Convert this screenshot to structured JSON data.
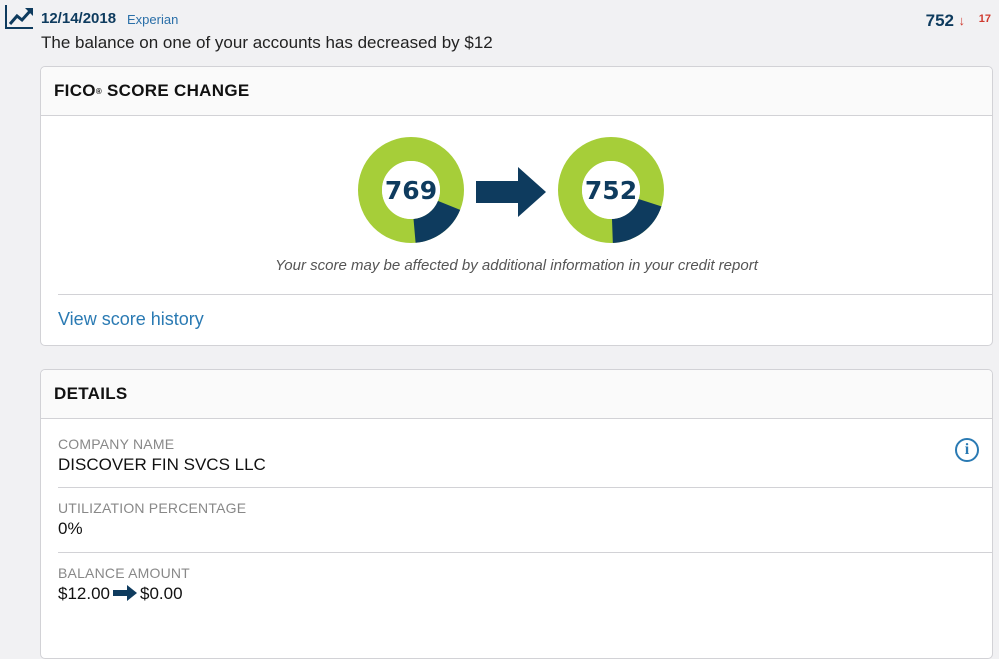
{
  "alert": {
    "icon": "trend-up-icon",
    "date": "12/14/2018",
    "bureau": "Experian",
    "message": "The balance on one of your accounts has decreased by $12",
    "score": "752",
    "delta_arrow": "↓",
    "delta": "17"
  },
  "fico_card": {
    "title": "FICO",
    "title_mark": "®",
    "title_rest": " SCORE CHANGE",
    "old_score": "769",
    "new_score": "752",
    "note": "Your score may be affected by additional information in your credit report",
    "history_link": "View score history"
  },
  "details_card": {
    "title": "DETAILS",
    "company_label": "COMPANY NAME",
    "company_value": "DISCOVER FIN SVCS LLC",
    "utilization_label": "UTILIZATION PERCENTAGE",
    "utilization_value": "0%",
    "balance_label": "BALANCE AMOUNT",
    "balance_old": "$12.00",
    "balance_new": "$0.00",
    "info_icon": "info-icon",
    "info_glyph": "i"
  },
  "colors": {
    "gauge_green": "#a6ce39",
    "gauge_navy": "#0e3b5e",
    "link_blue": "#2a7ab3",
    "alert_red": "#d03a2f"
  }
}
